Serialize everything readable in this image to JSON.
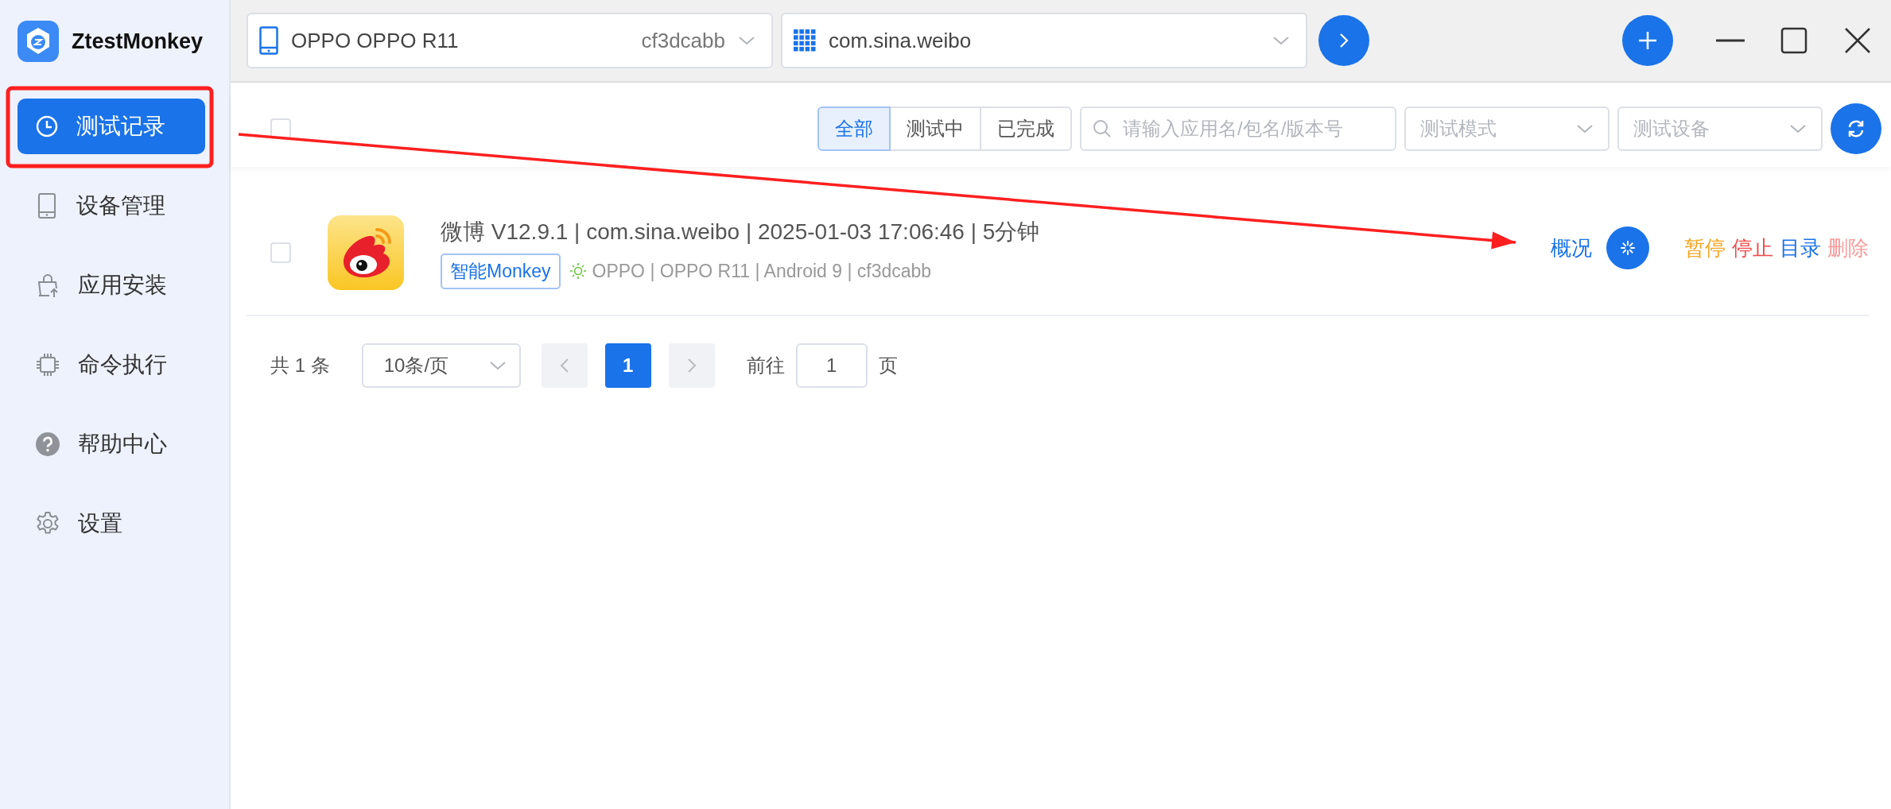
{
  "app": {
    "name": "ZtestMonkey"
  },
  "sidebar": {
    "items": [
      {
        "label": "测试记录",
        "selected": true
      },
      {
        "label": "设备管理",
        "selected": false
      },
      {
        "label": "应用安装",
        "selected": false
      },
      {
        "label": "命令执行",
        "selected": false
      },
      {
        "label": "帮助中心",
        "selected": false
      },
      {
        "label": "设置",
        "selected": false
      }
    ]
  },
  "topbar": {
    "device": {
      "name": "OPPO OPPO R11",
      "serial": "cf3dcabb"
    },
    "app": {
      "package": "com.sina.weibo"
    }
  },
  "toolbar": {
    "select_all": {
      "checked": false
    },
    "tabs": [
      {
        "label": "全部",
        "selected": true
      },
      {
        "label": "测试中",
        "selected": false
      },
      {
        "label": "已完成",
        "selected": false
      }
    ],
    "search": {
      "placeholder": "请输入应用名/包名/版本号"
    },
    "mode_select": {
      "placeholder": "测试模式"
    },
    "device_select": {
      "placeholder": "测试设备"
    }
  },
  "records": [
    {
      "checked": false,
      "title": "微博 V12.9.1 | com.sina.weibo | 2025-01-03 17:06:46 | 5分钟",
      "tag": "智能Monkey",
      "device": "OPPO | OPPO R11 | Android 9 | cf3dcabb",
      "overview": "概况",
      "actions": [
        {
          "label": "暂停",
          "color": "#f5a623"
        },
        {
          "label": "停止",
          "color": "#f04a4a"
        },
        {
          "label": "目录",
          "color": "#1a73e8"
        },
        {
          "label": "删除",
          "color": "#f79a9a"
        }
      ]
    }
  ],
  "pagination": {
    "total": "共 1 条",
    "page_size": "10条/页",
    "pages": [
      {
        "label": "1",
        "selected": true
      }
    ],
    "goto_label": "前往",
    "goto_value": "1",
    "goto_suffix": "页"
  },
  "annotations": [
    {
      "kind": "box"
    },
    {
      "kind": "arrow"
    }
  ]
}
